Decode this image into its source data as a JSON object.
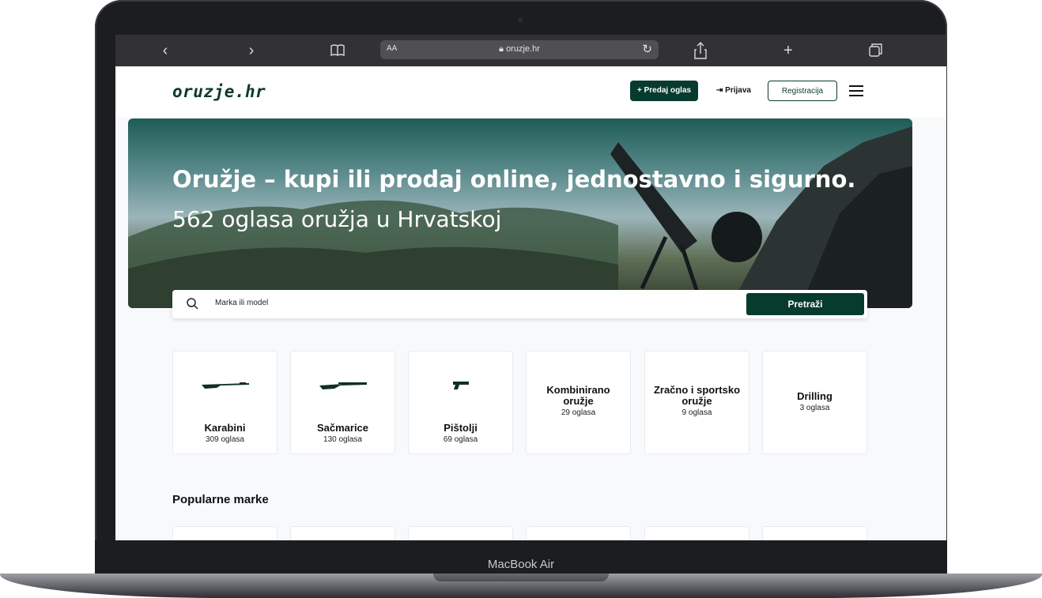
{
  "device": {
    "label": "MacBook Air"
  },
  "browser": {
    "text_size_label": "AA",
    "url": "oruzje.hr",
    "icons": [
      "back-icon",
      "forward-icon",
      "bookmarks-icon",
      "lock-icon",
      "reload-icon",
      "share-icon",
      "new-tab-icon",
      "tabs-icon"
    ]
  },
  "header": {
    "logo": "oruzje.hr",
    "sell_label": "+ Predaj oglas",
    "login_label": "Prijava",
    "register_label": "Registracija"
  },
  "hero": {
    "title": "Oružje – kupi ili prodaj online, jednostavno i sigurno.",
    "subtitle": "562 oglasa oružja u Hrvatskoj"
  },
  "search": {
    "placeholder": "Marka ili model",
    "button_label": "Pretraži"
  },
  "categories": [
    {
      "name": "Karabini",
      "count": "309 oglasa",
      "icon": "rifle-icon"
    },
    {
      "name": "Sačmarice",
      "count": "130 oglasa",
      "icon": "shotgun-icon"
    },
    {
      "name": "Pištolji",
      "count": "69 oglasa",
      "icon": "pistol-icon"
    },
    {
      "name": "Kombinirano oružje",
      "count": "29 oglasa"
    },
    {
      "name": "Zračno i sportsko oružje",
      "count": "9 oglasa"
    },
    {
      "name": "Drilling",
      "count": "3 oglasa"
    }
  ],
  "popular": {
    "title": "Popularne marke"
  },
  "colors": {
    "brand": "#063b2d",
    "page_bg": "#f7f9fb"
  }
}
